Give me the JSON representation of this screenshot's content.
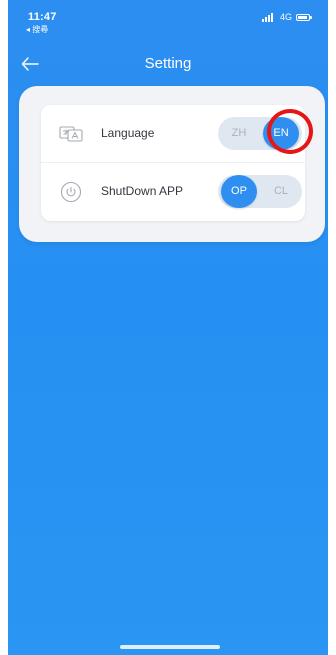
{
  "status_bar": {
    "time": "11:47",
    "back_app": "◂ 搜尋",
    "network": "4G"
  },
  "header": {
    "title": "Setting",
    "back_icon": "arrow-left-icon"
  },
  "settings": {
    "language": {
      "label": "Language",
      "icon": "translate-icon",
      "option_left": "ZH",
      "option_right": "EN",
      "selected": "EN"
    },
    "shutdown": {
      "label": "ShutDown APP",
      "icon": "power-icon",
      "option_left": "OP",
      "option_right": "CL",
      "selected": "OP"
    }
  },
  "colors": {
    "background_blue": "#2a90f2",
    "toggle_active": "#2f8ff0",
    "toggle_track": "#dfe8f1",
    "highlight": "#e61616"
  }
}
